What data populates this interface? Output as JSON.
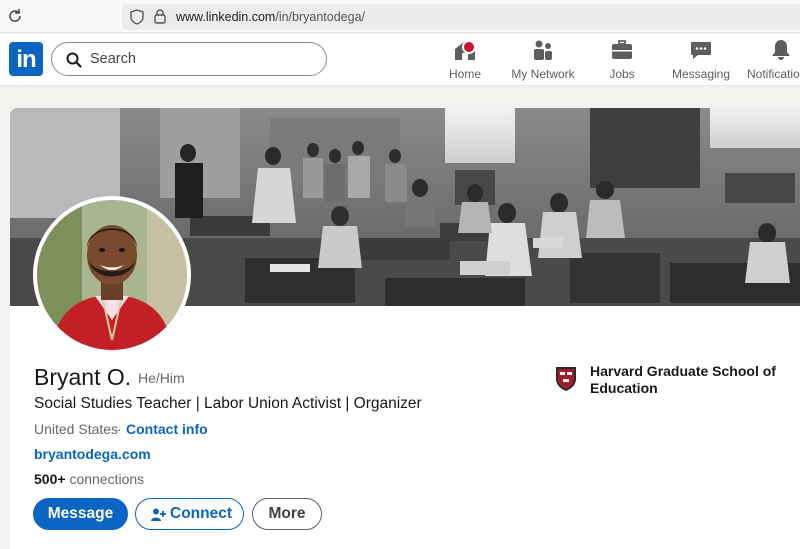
{
  "browser": {
    "url_host": "www.linkedin.com",
    "url_path": "/in/bryantodega/"
  },
  "nav": {
    "search_placeholder": "Search",
    "items": [
      {
        "label": "Home",
        "icon": "home-icon"
      },
      {
        "label": "My Network",
        "icon": "my-network-icon"
      },
      {
        "label": "Jobs",
        "icon": "briefcase-icon"
      },
      {
        "label": "Messaging",
        "icon": "messaging-icon"
      },
      {
        "label": "Notifications",
        "icon": "bell-icon"
      }
    ],
    "logo_text": "in"
  },
  "profile": {
    "name": "Bryant O.",
    "pronouns": "He/Him",
    "headline": "Social Studies Teacher | Labor Union Activist | Organizer",
    "location": "United States",
    "separator": "·",
    "contact_info": "Contact info",
    "website": "bryantodega.com",
    "connections_count": "500+",
    "connections_label": "connections",
    "education": "Harvard Graduate School of Education"
  },
  "actions": {
    "message": "Message",
    "connect": "Connect",
    "more": "More"
  },
  "colors": {
    "brand": "#0a66c2",
    "notification": "#cb112d"
  }
}
